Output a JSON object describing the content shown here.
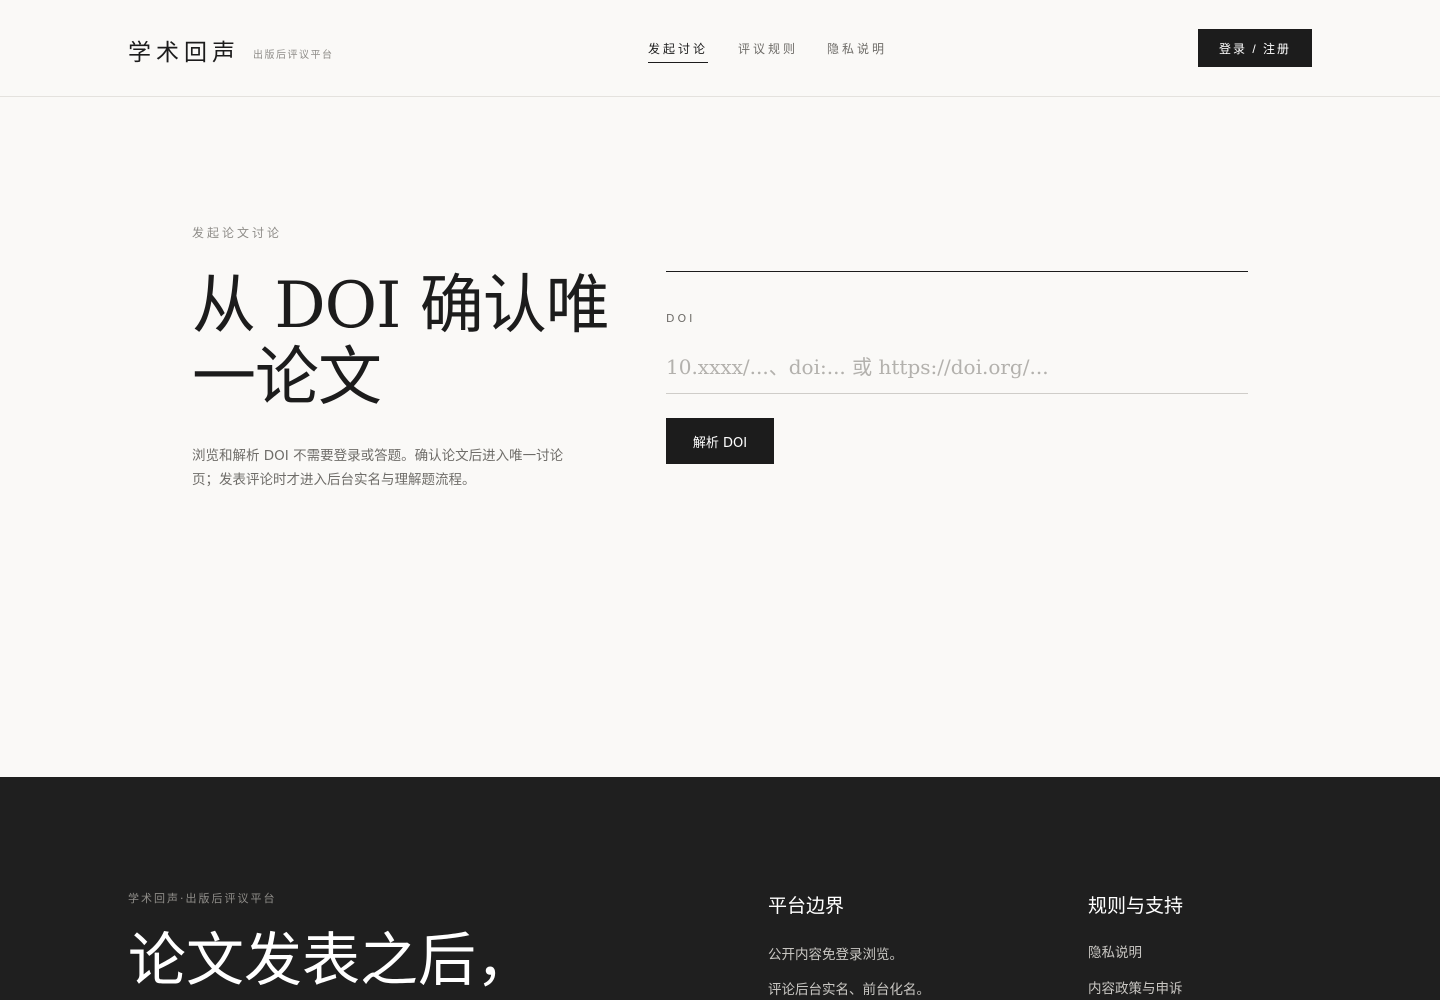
{
  "header": {
    "brand": "学术回声",
    "brand_sub": "出版后评议平台",
    "nav": [
      "发起讨论",
      "评议规则",
      "隐私说明"
    ],
    "login_label": "登录 / 注册"
  },
  "hero": {
    "eyebrow": "发起论文讨论",
    "title": "从 DOI 确认唯一论文",
    "description": "浏览和解析 DOI 不需要登录或答题。确认论文后进入唯一讨论页；发表评论时才进入后台实名与理解题流程。"
  },
  "form": {
    "label": "DOI",
    "placeholder": "10.xxxx/...、doi:... 或 https://doi.org/...",
    "value": "",
    "submit_label": "解析 DOI"
  },
  "footer": {
    "eyebrow": "学术回声·出版后评议平台",
    "title": "论文发表之后，",
    "col1": {
      "title": "平台边界",
      "items": [
        "公开内容免登录浏览。",
        "评论后台实名、前台化名。"
      ]
    },
    "col2": {
      "title": "规则与支持",
      "items": [
        "隐私说明",
        "内容政策与申诉"
      ]
    }
  },
  "colors": {
    "background": "#faf9f7",
    "ink": "#1c1c1c",
    "muted": "#8f8d89",
    "footer_bg": "#1f1f1f"
  }
}
